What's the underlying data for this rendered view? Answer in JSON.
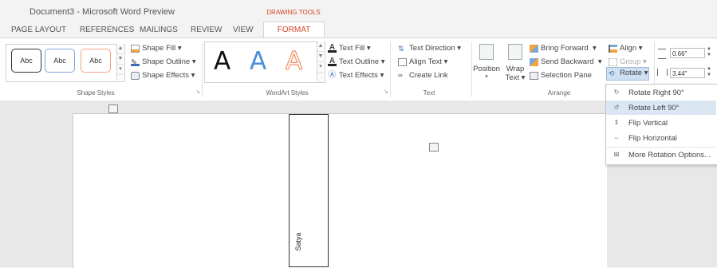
{
  "window": {
    "title": "Document3 - Microsoft Word Preview",
    "contextual_group": "DRAWING TOOLS"
  },
  "tabs": [
    {
      "label": "PAGE LAYOUT"
    },
    {
      "label": "REFERENCES"
    },
    {
      "label": "MAILINGS"
    },
    {
      "label": "REVIEW"
    },
    {
      "label": "VIEW"
    },
    {
      "label": "FORMAT"
    }
  ],
  "shape_styles": {
    "presets": [
      "Abc",
      "Abc",
      "Abc"
    ],
    "shape_fill": "Shape Fill",
    "shape_outline": "Shape Outline",
    "shape_effects": "Shape Effects",
    "group_label": "Shape Styles"
  },
  "wordart_styles": {
    "letters": [
      "A",
      "A",
      "A"
    ],
    "text_fill": "Text Fill",
    "text_outline": "Text Outline",
    "text_effects": "Text Effects",
    "group_label": "WordArt Styles"
  },
  "text_group": {
    "text_direction": "Text Direction",
    "align_text": "Align Text",
    "create_link": "Create Link",
    "group_label": "Text"
  },
  "arrange": {
    "position": "Position",
    "wrap_text_1": "Wrap",
    "wrap_text_2": "Text",
    "bring_forward": "Bring Forward",
    "send_backward": "Send Backward",
    "selection_pane": "Selection Pane",
    "align": "Align",
    "group": "Group",
    "rotate": "Rotate",
    "group_label": "Arrange"
  },
  "size": {
    "height": "0.66\"",
    "width": "3.44\""
  },
  "rotate_menu": {
    "items": [
      {
        "label": "Rotate Right 90°",
        "icon": "rotate-right-icon",
        "highlighted": false
      },
      {
        "label": "Rotate Left 90°",
        "icon": "rotate-left-icon",
        "highlighted": true
      },
      {
        "label": "Flip Vertical",
        "icon": "flip-vertical-icon",
        "highlighted": false
      },
      {
        "label": "Flip Horizontal",
        "icon": "flip-horizontal-icon",
        "highlighted": false
      },
      {
        "label": "More Rotation Options...",
        "icon": "more-options-icon",
        "highlighted": false
      }
    ]
  },
  "document": {
    "shape_text": "Satya"
  },
  "colors": {
    "accent": "#d24726",
    "wordart_blue": "#4a90d9",
    "wordart_orange": "#f4a582",
    "menu_highlight": "#dbe6f3"
  }
}
